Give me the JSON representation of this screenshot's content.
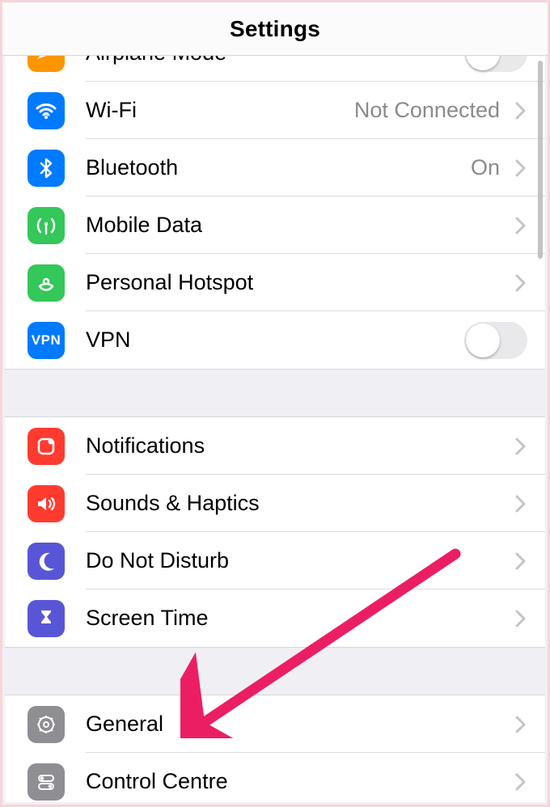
{
  "header": {
    "title": "Settings"
  },
  "groups": [
    {
      "rows": [
        {
          "id": "airplane-mode",
          "label": "Airplane Mode",
          "icon": "airplane-icon",
          "iconBg": "bg-orange",
          "accessory": "switch",
          "switchOn": false
        },
        {
          "id": "wifi",
          "label": "Wi-Fi",
          "icon": "wifi-icon",
          "iconBg": "bg-blue",
          "accessory": "disclosure",
          "value": "Not Connected"
        },
        {
          "id": "bluetooth",
          "label": "Bluetooth",
          "icon": "bluetooth-icon",
          "iconBg": "bg-blue",
          "accessory": "disclosure",
          "value": "On"
        },
        {
          "id": "mobile-data",
          "label": "Mobile Data",
          "icon": "antenna-icon",
          "iconBg": "bg-green",
          "accessory": "disclosure"
        },
        {
          "id": "personal-hotspot",
          "label": "Personal Hotspot",
          "icon": "hotspot-icon",
          "iconBg": "bg-green",
          "accessory": "disclosure"
        },
        {
          "id": "vpn",
          "label": "VPN",
          "icon": "vpn-icon",
          "iconBg": "bg-vpnblue",
          "accessory": "switch",
          "switchOn": false,
          "iconText": "VPN"
        }
      ]
    },
    {
      "rows": [
        {
          "id": "notifications",
          "label": "Notifications",
          "icon": "notifications-icon",
          "iconBg": "bg-red",
          "accessory": "disclosure"
        },
        {
          "id": "sounds-haptics",
          "label": "Sounds & Haptics",
          "icon": "speaker-icon",
          "iconBg": "bg-red",
          "accessory": "disclosure"
        },
        {
          "id": "do-not-disturb",
          "label": "Do Not Disturb",
          "icon": "moon-icon",
          "iconBg": "bg-moon",
          "accessory": "disclosure"
        },
        {
          "id": "screen-time",
          "label": "Screen Time",
          "icon": "hourglass-icon",
          "iconBg": "bg-indigo",
          "accessory": "disclosure"
        }
      ]
    },
    {
      "rows": [
        {
          "id": "general",
          "label": "General",
          "icon": "gear-icon",
          "iconBg": "bg-grey",
          "accessory": "disclosure"
        },
        {
          "id": "control-centre",
          "label": "Control Centre",
          "icon": "toggles-icon",
          "iconBg": "bg-grey",
          "accessory": "disclosure"
        }
      ]
    }
  ],
  "annotation": {
    "target": "general",
    "color": "#ec1e63"
  }
}
